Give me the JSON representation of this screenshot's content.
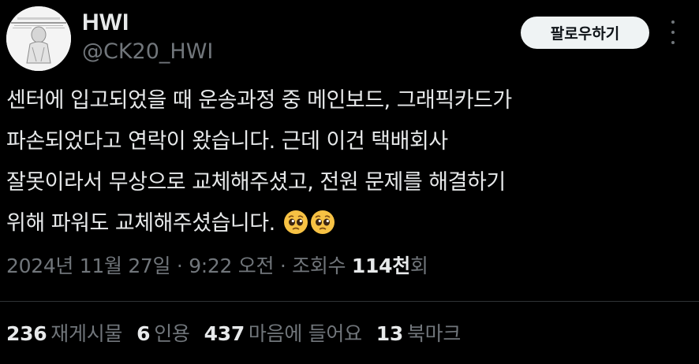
{
  "author": {
    "display_name": "HWI",
    "handle": "@CK20_HWI",
    "avatar": "avatar-image"
  },
  "follow_button_label": "팔로우하기",
  "more_icon": "more-dots-icon",
  "tweet": {
    "lines": [
      "센터에 입고되었을 때 운송과정 중 메인보드, 그래픽카드가",
      "파손되었다고 연락이 왔습니다. 근데 이건 택배회사",
      "잘못이라서 무상으로 교체해주셨고, 전원 문제를 해결하기",
      "위해 파워도 교체해주셨습니다."
    ],
    "emojis": [
      "pleading-face-emoji",
      "pleading-face-emoji"
    ]
  },
  "meta": {
    "date": "2024년 11월 27일",
    "sep1": " · ",
    "time": "9:22 오전",
    "sep2": " · ",
    "views_label_prefix": "조회수 ",
    "views_count": "114천",
    "views_label_suffix": "회"
  },
  "stats": {
    "reposts_count": "236",
    "reposts_label": "재게시물",
    "quotes_count": "6",
    "quotes_label": "인용",
    "likes_count": "437",
    "likes_label": "마음에 들어요",
    "bookmarks_count": "13",
    "bookmarks_label": "북마크"
  },
  "colors": {
    "background": "#000000",
    "text_primary": "#e7e9ea",
    "text_secondary": "#71767b",
    "button_bg": "#eff3f4",
    "divider": "#2f3336",
    "emoji_yellow": "#f7c244"
  }
}
